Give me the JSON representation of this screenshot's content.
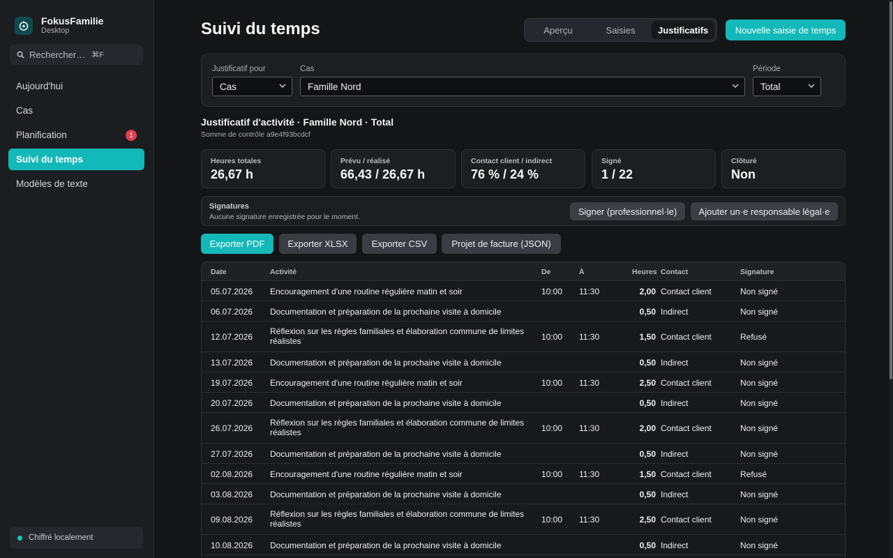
{
  "app": {
    "name": "FokusFamilie",
    "subtitle": "Desktop"
  },
  "search": {
    "placeholder": "Rechercher…",
    "shortcut": "⌘F"
  },
  "nav": [
    {
      "label": "Aujourd'hui",
      "active": false
    },
    {
      "label": "Cas",
      "active": false
    },
    {
      "label": "Planification",
      "active": false,
      "badge": "1"
    },
    {
      "label": "Suivi du temps",
      "active": true
    },
    {
      "label": "Modèles de texte",
      "active": false
    }
  ],
  "footer": {
    "status": "Chiffré localement"
  },
  "header": {
    "title": "Suivi du temps",
    "tabs": [
      {
        "label": "Aperçu",
        "active": false
      },
      {
        "label": "Saisies",
        "active": false
      },
      {
        "label": "Justificatifs",
        "active": true
      }
    ],
    "new_button": "Nouvelle saisie de temps"
  },
  "filters": {
    "for_label": "Justificatif pour",
    "for_value": "Cas",
    "case_label": "Cas",
    "case_value": "Famille Nord",
    "period_label": "Période",
    "period_value": "Total"
  },
  "report": {
    "title": "Justificatif d'activité · Famille Nord · Total",
    "checksum": "Somme de contrôle a9e4f93bcdcf"
  },
  "stats": [
    {
      "label": "Heures totales",
      "value": "26,67 h"
    },
    {
      "label": "Prévu / réalisé",
      "value": "66,43 / 26,67 h"
    },
    {
      "label": "Contact client / indirect",
      "value": "76 % / 24 %"
    },
    {
      "label": "Signé",
      "value": "1 / 22"
    },
    {
      "label": "Clôturé",
      "value": "Non"
    }
  ],
  "signatures": {
    "title": "Signatures",
    "subtitle": "Aucune signature enregistrée pour le moment.",
    "sign_button": "Signer (professionnel·le)",
    "add_button": "Ajouter un·e responsable légal·e"
  },
  "exports": [
    "Exporter PDF",
    "Exporter XLSX",
    "Exporter CSV",
    "Projet de facture (JSON)"
  ],
  "table": {
    "columns": [
      "Date",
      "Activité",
      "De",
      "À",
      "Heures",
      "Contact",
      "Signature"
    ],
    "rows": [
      {
        "date": "05.07.2026",
        "activity": "Encouragement d'une routine régulière matin et soir",
        "from": "10:00",
        "to": "11:30",
        "hours": "2,00",
        "contact": "Contact client",
        "signature": "Non signé"
      },
      {
        "date": "06.07.2026",
        "activity": "Documentation et préparation de la prochaine visite à domicile",
        "from": "",
        "to": "",
        "hours": "0,50",
        "contact": "Indirect",
        "signature": "Non signé"
      },
      {
        "date": "12.07.2026",
        "activity": "Réflexion sur les règles familiales et élaboration commune de limites réalistes",
        "from": "10:00",
        "to": "11:30",
        "hours": "1,50",
        "contact": "Contact client",
        "signature": "Refusé"
      },
      {
        "date": "13.07.2026",
        "activity": "Documentation et préparation de la prochaine visite à domicile",
        "from": "",
        "to": "",
        "hours": "0,50",
        "contact": "Indirect",
        "signature": "Non signé"
      },
      {
        "date": "19.07.2026",
        "activity": "Encouragement d'une routine régulière matin et soir",
        "from": "10:00",
        "to": "11:30",
        "hours": "2,50",
        "contact": "Contact client",
        "signature": "Non signé"
      },
      {
        "date": "20.07.2026",
        "activity": "Documentation et préparation de la prochaine visite à domicile",
        "from": "",
        "to": "",
        "hours": "0,50",
        "contact": "Indirect",
        "signature": "Non signé"
      },
      {
        "date": "26.07.2026",
        "activity": "Réflexion sur les règles familiales et élaboration commune de limites réalistes",
        "from": "10:00",
        "to": "11:30",
        "hours": "2,00",
        "contact": "Contact client",
        "signature": "Non signé"
      },
      {
        "date": "27.07.2026",
        "activity": "Documentation et préparation de la prochaine visite à domicile",
        "from": "",
        "to": "",
        "hours": "0,50",
        "contact": "Indirect",
        "signature": "Non signé"
      },
      {
        "date": "02.08.2026",
        "activity": "Encouragement d'une routine régulière matin et soir",
        "from": "10:00",
        "to": "11:30",
        "hours": "1,50",
        "contact": "Contact client",
        "signature": "Refusé"
      },
      {
        "date": "03.08.2026",
        "activity": "Documentation et préparation de la prochaine visite à domicile",
        "from": "",
        "to": "",
        "hours": "0,50",
        "contact": "Indirect",
        "signature": "Non signé"
      },
      {
        "date": "09.08.2026",
        "activity": "Réflexion sur les règles familiales et élaboration commune de limites réalistes",
        "from": "10:00",
        "to": "11:30",
        "hours": "2,50",
        "contact": "Contact client",
        "signature": "Non signé"
      },
      {
        "date": "10.08.2026",
        "activity": "Documentation et préparation de la prochaine visite à domicile",
        "from": "",
        "to": "",
        "hours": "0,50",
        "contact": "Indirect",
        "signature": "Non signé"
      }
    ]
  },
  "colors": {
    "accent": "#13b8b8",
    "badge": "#e0404b",
    "background": "#141517"
  }
}
